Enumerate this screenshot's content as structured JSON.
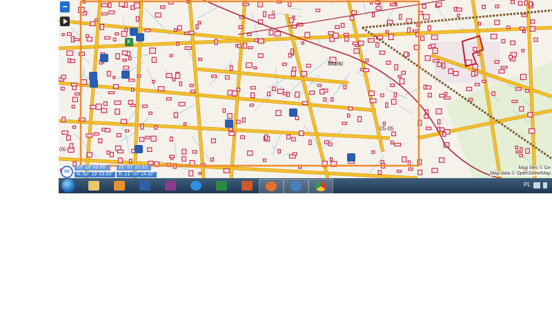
{
  "map": {
    "controls": {
      "zoom_in": "+",
      "zoom_out": "−",
      "play": "play"
    },
    "place_name": "Marki",
    "parcel_labels": [
      "05-05",
      "06-",
      "0",
      "Mar"
    ],
    "coordinates": {
      "n_top": "53° 19' 03.55\"",
      "e_top": "21° 07' 22.51\"",
      "n": "N: 52° 19' 03.93\"",
      "e": "E: 21° 07' 24.32\""
    },
    "attribution": {
      "tiles": "Map tiles © Ge",
      "data": "Map data © OpenStreetMap"
    },
    "poi_letters": [
      "K"
    ]
  },
  "taskbar": {
    "apps": [
      {
        "name": "start",
        "icon": "windows-start-icon"
      },
      {
        "name": "explorer",
        "icon": "folder-icon"
      },
      {
        "name": "media",
        "icon": "media-player-icon"
      },
      {
        "name": "word",
        "icon": "word-icon"
      },
      {
        "name": "winrar",
        "icon": "archive-icon"
      },
      {
        "name": "ie",
        "icon": "ie-icon"
      },
      {
        "name": "excel",
        "icon": "excel-icon"
      },
      {
        "name": "powerpoint",
        "icon": "powerpoint-icon"
      },
      {
        "name": "firefox",
        "icon": "firefox-icon"
      },
      {
        "name": "thunderbird",
        "icon": "mail-icon"
      },
      {
        "name": "chrome",
        "icon": "chrome-icon"
      }
    ],
    "language": "PL",
    "colors": {
      "road": "#f2c12e",
      "building": "#c2183a",
      "frame": "#f08a2e",
      "boundary": "#b03040"
    }
  }
}
